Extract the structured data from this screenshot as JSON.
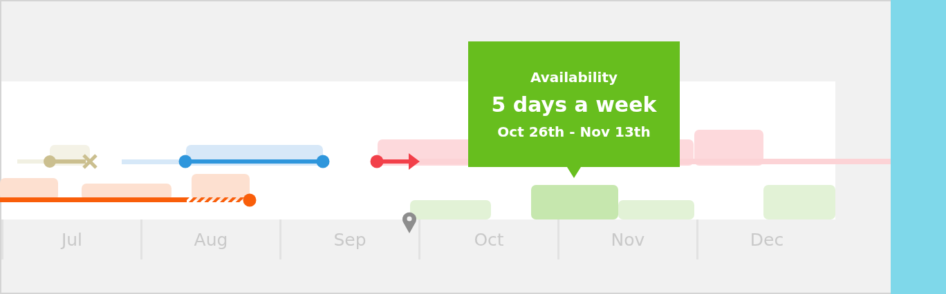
{
  "tooltip": {
    "title": "Availability",
    "value": "5 days a week",
    "dates": "Oct 26th - Nov 13th"
  },
  "months": [
    {
      "label": "Jul"
    },
    {
      "label": "Aug"
    },
    {
      "label": "Sep"
    },
    {
      "label": "Oct"
    },
    {
      "label": "Nov"
    },
    {
      "label": "Dec"
    }
  ]
}
